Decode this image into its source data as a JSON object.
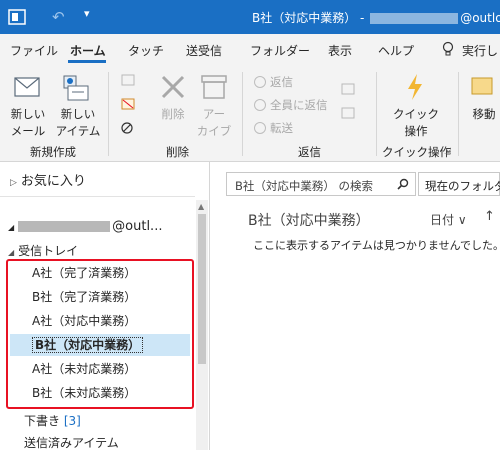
{
  "window": {
    "title_prefix": "B社（対応中業務） - ",
    "title_suffix": "@outlook.",
    "title_accent": "#1a6fc4"
  },
  "tabs": [
    "ファイル",
    "ホーム",
    "タッチ",
    "送受信",
    "フォルダー",
    "表示",
    "ヘルプ",
    "実行し"
  ],
  "active_tab": "ホーム",
  "ribbon": {
    "new_mail": "新しい\nメール",
    "new_items": "新しい\nアイテム",
    "group_new": "新規作成",
    "delete": "削除",
    "archive": "アー\nカイブ",
    "group_delete": "削除",
    "reply": "返信",
    "reply_all": "全員に返信",
    "forward": "転送",
    "group_respond": "返信",
    "quick_steps": "クイック\n操作",
    "group_quick": "クイック操作",
    "move": "移動"
  },
  "folder_pane": {
    "favorites": "お気に入り",
    "account_suffix": "@outl...",
    "inbox": "受信トレイ",
    "folders": [
      {
        "label": "A社（完了済業務）"
      },
      {
        "label": "B社（完了済業務）"
      },
      {
        "label": "A社（対応中業務）"
      },
      {
        "label": "B社（対応中業務）",
        "selected": true
      },
      {
        "label": "A社（未対応業務）"
      },
      {
        "label": "B社（未対応業務）"
      }
    ],
    "drafts": "下書き",
    "drafts_count": "[3]",
    "sent": "送信済みアイテム",
    "highlight_color": "#e81123"
  },
  "mail_pane": {
    "search_placeholder": "B社（対応中業務） の検索",
    "scope": "現在のフォルダー",
    "folder_title": "B社（対応中業務）",
    "sort": "日付 ∨",
    "sort_dir": "↑",
    "empty_message": "ここに表示するアイテムは見つかりませんでした。"
  }
}
